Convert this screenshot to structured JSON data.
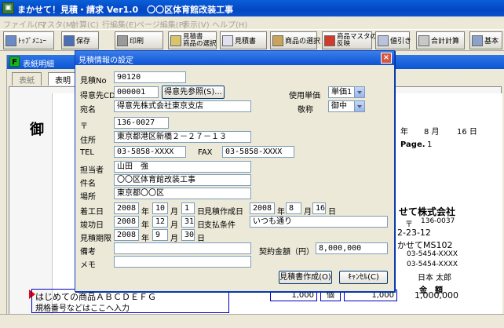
{
  "window": {
    "title": "まかせて！見積・請求 Ver1.0　〇〇区体育館改装工事"
  },
  "menu": [
    "ファイル(F)",
    "マスタ(M)",
    "計算(C)",
    "行編集(E)",
    "ページ編集(P)",
    "表示(V)",
    "ヘルプ(H)"
  ],
  "toolbar": {
    "top_menu": "ﾄｯﾌﾟﾒﾆｭｰ",
    "save": "保存",
    "print": "印刷",
    "select_quote_1": "見積書",
    "select_quote_2": "商品の選択",
    "quote": "見積書",
    "select_product": "商品の選択",
    "reflect_master_1": "商品マスタの",
    "reflect_master_2": "反映",
    "discount": "値引き",
    "total_calc": "合計計算",
    "basic": "基本"
  },
  "child": {
    "title": "表紙明細",
    "tab_cover": "表紙",
    "tab_detail": "表明"
  },
  "document": {
    "heading": "御",
    "date_year_suffix": "年",
    "date_month": "8 月",
    "date_day": "16 日",
    "page_label": "Page.",
    "page_num": "1",
    "company": "せて株式会社",
    "zip_mark": "〒",
    "zip": "136-0037",
    "addr": "2-23-12",
    "building": "かせてMS102",
    "tel": "03-5454-XXXX",
    "fax": "03-5454-XXXX",
    "person": "日本 太郎",
    "amount_header": "金　額",
    "item_name": "はじめての商品ＡＢＣＤＥＦＧ",
    "item_spec": "規格番号などはここへ入力",
    "item_qty": "1,000",
    "item_unit": "個",
    "item_price": "1,000",
    "item_amount": "1,000,000"
  },
  "dialog": {
    "title": "見積情報の設定",
    "close": "×",
    "quote_no_label": "見積No",
    "quote_no": "90120",
    "client_cd_label": "得意先CD",
    "client_cd": "000001",
    "client_ref_button": "得意先参照(S)...",
    "unit_label": "使用単価",
    "unit_value": "単価1",
    "honorific_label": "敬称",
    "honorific_value": "御中",
    "name_label": "宛名",
    "name_value": "得意先株式会社東京支店",
    "zip_label": "〒",
    "zip_value": "136-0027",
    "address_label": "住所",
    "address_value": "東京都港区新橋２－２７－１３",
    "tel_label": "TEL",
    "tel_value": "03-5858-XXXX",
    "fax_label": "FAX",
    "fax_value": "03-5858-XXXX",
    "person_label": "担当者",
    "person_value": "山田　強",
    "subject_label": "件名",
    "subject_value": "〇〇区体育館改装工事",
    "place_label": "場所",
    "place_value": "東京都〇〇区",
    "start_label": "着工日",
    "start_year": "2008",
    "start_month": "10",
    "start_day": "1",
    "created_label": "見積作成日",
    "created_year": "2008",
    "created_month": "8",
    "created_day": "16",
    "finish_label": "竣功日",
    "finish_year": "2008",
    "finish_month": "12",
    "finish_day": "31",
    "payment_label": "支払条件",
    "payment_value": "いつも通り",
    "deadline_label": "見積期限",
    "deadline_year": "2008",
    "deadline_month": "9",
    "deadline_day": "30",
    "note_label": "備考",
    "note_value": "",
    "contract_label": "契約金額（円）",
    "contract_value": "8,000,000",
    "memo_label": "メモ",
    "memo_value": "",
    "unit_year": "年",
    "unit_month": "月",
    "unit_day": "日",
    "create_button": "見積書作成(O)",
    "cancel_button": "ｷｬﾝｾﾙ(C)"
  }
}
